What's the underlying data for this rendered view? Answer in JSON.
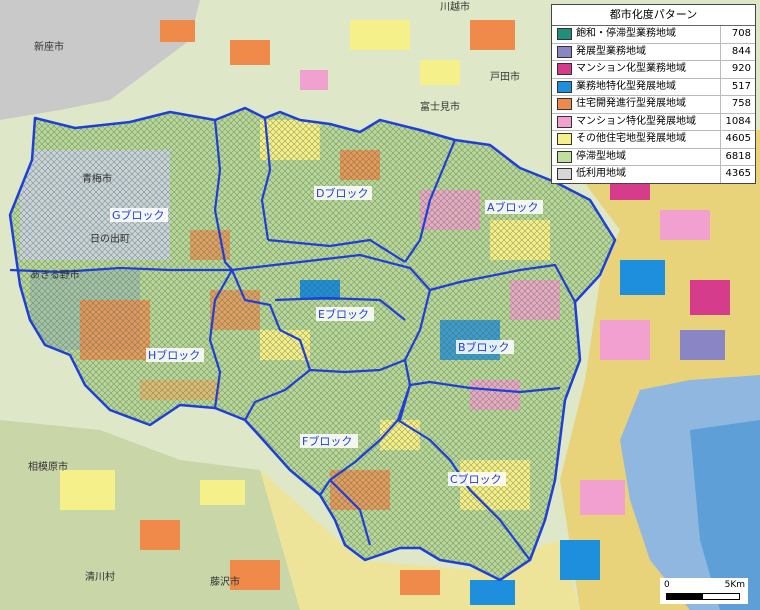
{
  "legend": {
    "title": "都市化度パターン",
    "items": [
      {
        "label": "飽和・停滞型業務地域",
        "count": "708",
        "color": "#1f8f7a"
      },
      {
        "label": "発展型業務地域",
        "count": "844",
        "color": "#8a86c6"
      },
      {
        "label": "マンション化型業務地域",
        "count": "920",
        "color": "#d63c8c"
      },
      {
        "label": "業務地特化型発展地域",
        "count": "517",
        "color": "#1d8fdc"
      },
      {
        "label": "住宅開発進行型発展地域",
        "count": "758",
        "color": "#f08a4b"
      },
      {
        "label": "マンション特化型発展地域",
        "count": "1084",
        "color": "#f2a0cf"
      },
      {
        "label": "その他住宅地型発展地域",
        "count": "4605",
        "color": "#f6f08a"
      },
      {
        "label": "停滞型地域",
        "count": "6818",
        "color": "#bfe09a"
      },
      {
        "label": "低利用地域",
        "count": "4365",
        "color": "#d6d6d6"
      }
    ]
  },
  "blocks": [
    {
      "label": "Aブロック"
    },
    {
      "label": "Bブロック"
    },
    {
      "label": "Cブロック"
    },
    {
      "label": "Dブロック"
    },
    {
      "label": "Eブロック"
    },
    {
      "label": "Fブロック"
    },
    {
      "label": "Gブロック"
    },
    {
      "label": "Hブロック"
    }
  ],
  "place_names": [
    {
      "label": "新座市"
    },
    {
      "label": "青梅市"
    },
    {
      "label": "日の出町"
    },
    {
      "label": "あきる野市"
    },
    {
      "label": "相模原市"
    },
    {
      "label": "清川村"
    },
    {
      "label": "藤沢市"
    },
    {
      "label": "富士見市"
    },
    {
      "label": "川越市"
    },
    {
      "label": "戸田市"
    }
  ],
  "scale": {
    "zero": "0",
    "end": "5Km"
  },
  "colors": {
    "boundary": "#1f3fd6",
    "water": "#8fb7e0"
  }
}
